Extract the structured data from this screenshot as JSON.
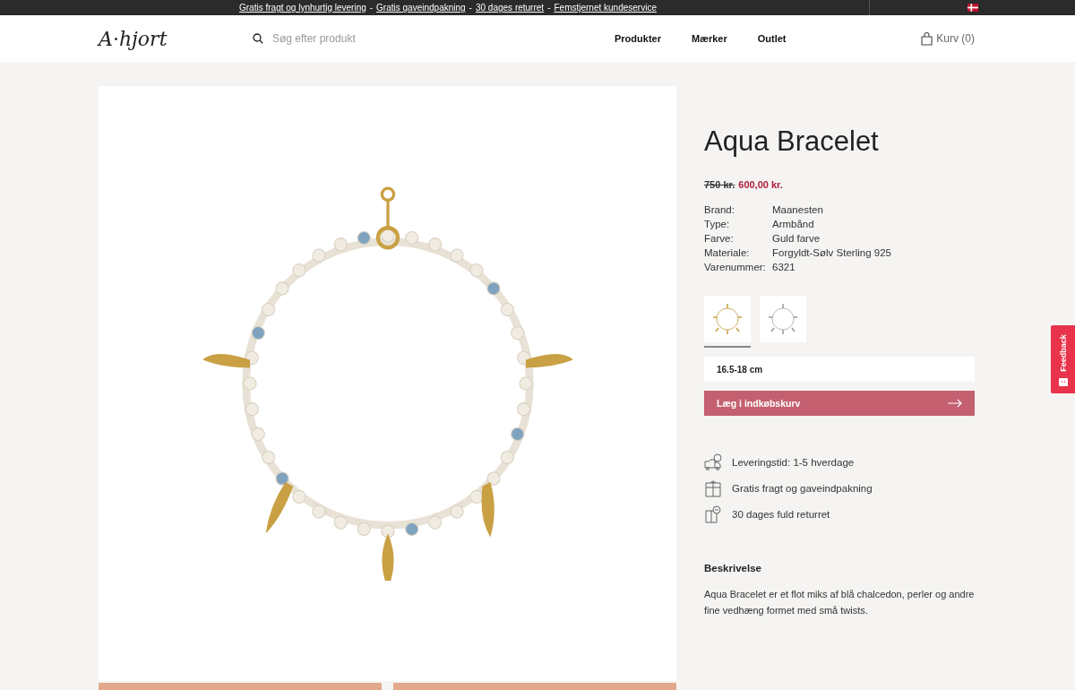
{
  "announcement": {
    "links": [
      "Gratis fragt og lynhurtig levering",
      "Gratis gaveindpakning",
      "30 dages returret",
      "Femstjernet kundeservice"
    ],
    "separator": "-"
  },
  "header": {
    "logo": "A·hjort",
    "search": {
      "placeholder": "Søg efter produkt"
    },
    "nav": [
      "Produkter",
      "Mærker",
      "Outlet"
    ],
    "cart": "Kurv (0)"
  },
  "product": {
    "title": "Aqua Bracelet",
    "old_price": "750 kr.",
    "price": "600,00 kr.",
    "specs": [
      {
        "label": "Brand:",
        "value": "Maanesten"
      },
      {
        "label": "Type:",
        "value": "Armbånd"
      },
      {
        "label": "Farve:",
        "value": "Guld farve"
      },
      {
        "label": "Materiale:",
        "value": "Forgyldt-Sølv Sterling 925"
      },
      {
        "label": "Varenummer:",
        "value": "6321"
      }
    ],
    "variants": [
      {
        "kind": "gold",
        "selected": true
      },
      {
        "kind": "silver",
        "selected": false
      }
    ],
    "size": "16.5-18 cm",
    "add_to_cart": "Læg i indkøbskurv",
    "usps": [
      {
        "kind": "delivery",
        "text": "Leveringstid: 1-5 hverdage"
      },
      {
        "kind": "gift",
        "text": "Gratis fragt og gaveindpakning"
      },
      {
        "kind": "return",
        "text": "30 dages fuld returret"
      }
    ],
    "description_title": "Beskrivelse",
    "description": "Aqua Bracelet er et flot miks af blå chalcedon, perler og andre fine vedhæng formet med små twists."
  },
  "feedback_tab": "Feedback"
}
